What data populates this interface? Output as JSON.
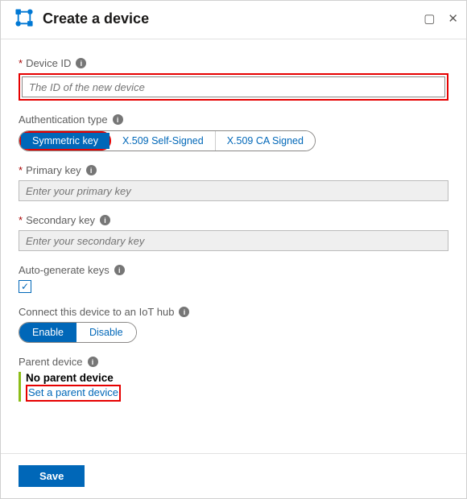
{
  "header": {
    "title": "Create a device"
  },
  "deviceId": {
    "label": "Device ID",
    "placeholder": "The ID of the new device"
  },
  "authType": {
    "label": "Authentication type",
    "options": [
      "Symmetric key",
      "X.509 Self-Signed",
      "X.509 CA Signed"
    ]
  },
  "primaryKey": {
    "label": "Primary key",
    "placeholder": "Enter your primary key"
  },
  "secondaryKey": {
    "label": "Secondary key",
    "placeholder": "Enter your secondary key"
  },
  "autoGenerate": {
    "label": "Auto-generate keys",
    "checked": true
  },
  "connectHub": {
    "label": "Connect this device to an IoT hub",
    "options": [
      "Enable",
      "Disable"
    ]
  },
  "parentDevice": {
    "label": "Parent device",
    "status": "No parent device",
    "link": "Set a parent device"
  },
  "footer": {
    "save": "Save"
  }
}
